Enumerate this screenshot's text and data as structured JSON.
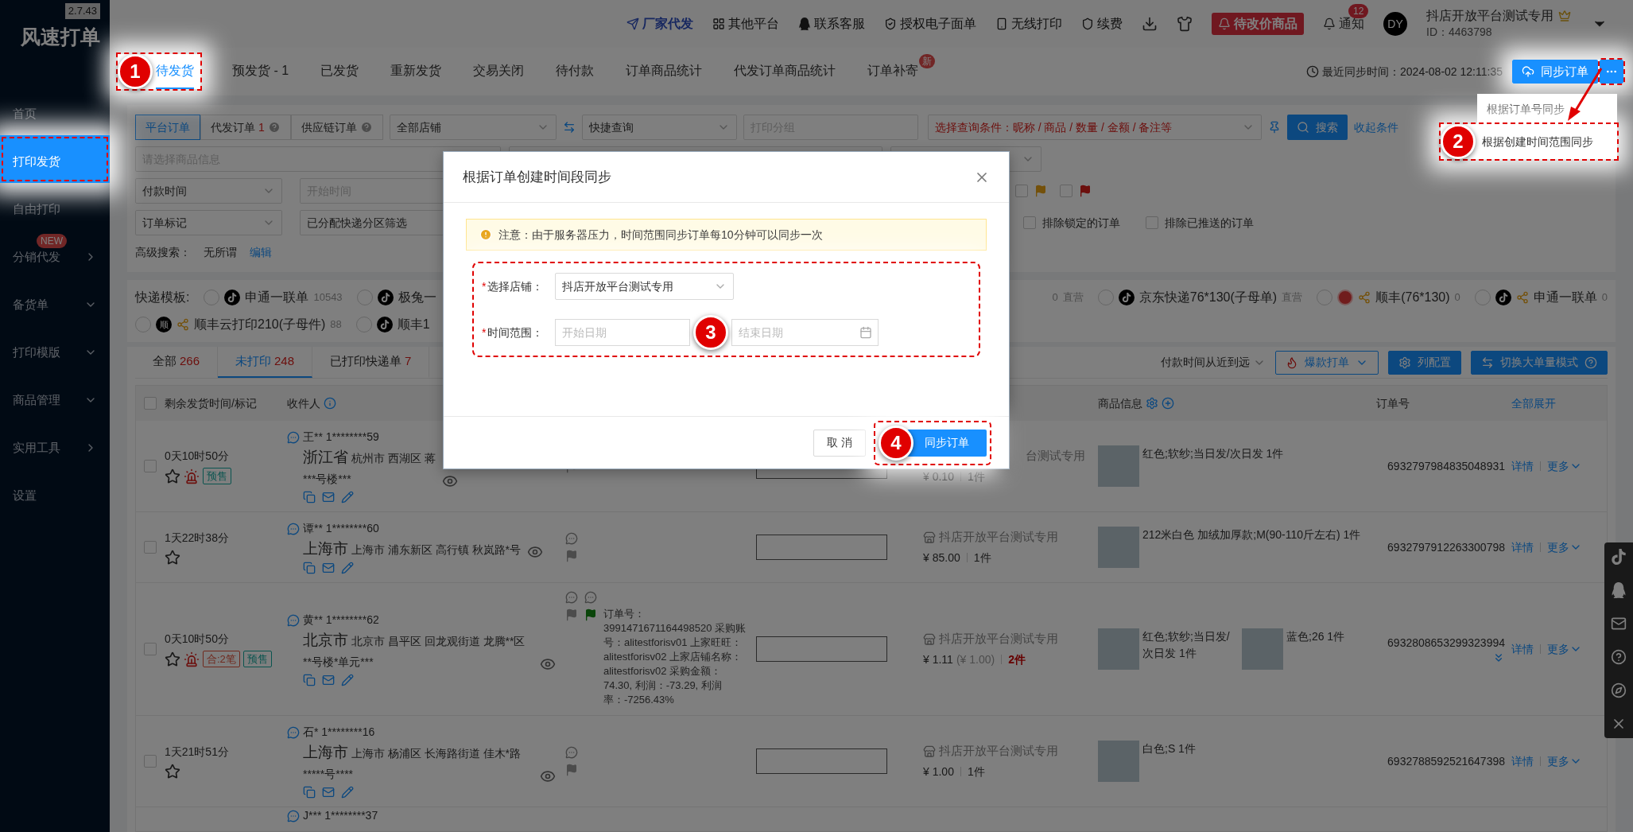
{
  "app": {
    "version": "2.7.43",
    "logo": "风速打单"
  },
  "sidebar": [
    {
      "label": "首页",
      "selected": false
    },
    {
      "label": "打印发货",
      "selected": true
    },
    {
      "label": "自由打印",
      "selected": false
    },
    {
      "label": "分销代发",
      "selected": false,
      "badge": "NEW",
      "kind": "submenu"
    },
    {
      "label": "备货单",
      "selected": false,
      "kind": "group"
    },
    {
      "label": "打印模版",
      "selected": false,
      "kind": "group"
    },
    {
      "label": "商品管理",
      "selected": false,
      "kind": "group"
    },
    {
      "label": "实用工具",
      "selected": false,
      "kind": "submenu"
    },
    {
      "label": "设置",
      "selected": false
    }
  ],
  "header": {
    "links": [
      {
        "label": "厂家代发",
        "kind": "featured"
      },
      {
        "label": "其他平台",
        "kind": "plain"
      },
      {
        "label": "联系客服",
        "kind": "plain"
      },
      {
        "label": "授权电子面单",
        "kind": "plain"
      },
      {
        "label": "无线打印",
        "kind": "plain"
      },
      {
        "label": "续费",
        "kind": "plain"
      }
    ],
    "alert_button": "待改价商品",
    "notifications": {
      "label": "通知",
      "count": "12"
    },
    "user": {
      "avatar": "DY",
      "name": "抖店开放平台测试专用",
      "id": "ID：4463798"
    }
  },
  "tabs": [
    {
      "label": "待发货",
      "selected": true
    },
    {
      "label": "预发货 - 1",
      "selected": false
    },
    {
      "label": "已发货",
      "selected": false
    },
    {
      "label": "重新发货",
      "selected": false
    },
    {
      "label": "交易关闭",
      "selected": false
    },
    {
      "label": "待付款",
      "selected": false
    },
    {
      "label": "订单商品统计",
      "selected": false
    },
    {
      "label": "代发订单商品统计",
      "selected": false
    },
    {
      "label": "订单补寄",
      "selected": false,
      "badge": "新"
    }
  ],
  "sync": {
    "last_sync": "最近同步时间：2024-08-02 12:11:35",
    "button": "同步订单",
    "menu_open": true,
    "menu": [
      "根据订单号同步",
      "根据创建时间范围同步"
    ]
  },
  "filters": {
    "sources": [
      {
        "label": "平台订单",
        "selected": true
      },
      {
        "label": "代发订单",
        "count": "1",
        "help": true,
        "selected": false
      },
      {
        "label": "供应链订单",
        "help": true,
        "selected": false
      }
    ],
    "shop_select": "全部店铺",
    "quick_query": "快捷查询",
    "print_group_placeholder": "打印分组",
    "condition_select": "选择查询条件：昵称 / 商品 / 数量 / 金额 / 备注等",
    "search_button": "搜索",
    "collapse_link": "收起条件",
    "product_placeholder": "请选择商品信息",
    "time_type": "付款时间",
    "start_time_placeholder": "开始时间",
    "flags": [
      {
        "color": "#74510b",
        "checked": false
      },
      {
        "color": "#6c100e",
        "checked": false
      }
    ],
    "mark_select": "订单标记",
    "zone_select": "已分配快递分区筛选",
    "checkboxes": [
      {
        "label": "排除锁定的订单",
        "checked": false
      },
      {
        "label": "排除已推送的订单",
        "checked": false
      }
    ],
    "advanced": {
      "label": "高级搜索：",
      "value": "无所谓",
      "link": "编辑"
    }
  },
  "templates": {
    "label": "快递模板:",
    "rows": [
      {
        "left": [
          {
            "name": "申通一联单",
            "count": "10543",
            "kind": "douyin",
            "selected": false
          },
          {
            "name": "极兔一",
            "kind": "douyin",
            "selected": false
          }
        ],
        "right": [
          {
            "count": "0",
            "tag": "直营"
          },
          {
            "name": "京东快递76*130(子母单)",
            "tag": "直营",
            "kind": "douyin",
            "selected": false
          },
          {
            "name": "顺丰(76*130)",
            "count": "0",
            "kind": "sf",
            "shared": true,
            "selected": false
          },
          {
            "name": "申通一联单",
            "count": "0",
            "kind": "douyin",
            "shared": true,
            "selected": false
          }
        ]
      },
      {
        "left": [
          {
            "name": "顺丰云打印210(子母件)",
            "count": "88",
            "kind": "shunfeng",
            "logo_text": "顺",
            "shared": true,
            "selected": false
          },
          {
            "name": "顺丰1",
            "kind": "douyin",
            "selected": false
          }
        ],
        "right": []
      }
    ]
  },
  "orders": {
    "tabs": [
      {
        "label": "全部",
        "count": "266",
        "selected": false
      },
      {
        "label": "未打印",
        "count": "248",
        "selected": true
      },
      {
        "label": "已打印快递单",
        "count": "7",
        "selected": false
      }
    ],
    "sort": "付款时间从近到远",
    "tools": [
      {
        "label": "爆款打单",
        "kind": "outline"
      },
      {
        "label": "列配置",
        "kind": "primary"
      },
      {
        "label": "切换大单量模式",
        "kind": "primary",
        "help": true
      }
    ],
    "columns": {
      "time": "剩余发货时间/标记",
      "recipient": "收件人",
      "product": "商品信息",
      "order_no": "订单号",
      "expand_all": "全部展开"
    },
    "select_all_checked": false,
    "rows": [
      {
        "checked": false,
        "remaining": "0天10时50分",
        "starred": false,
        "alarm": true,
        "tags": [
          {
            "label": "预售",
            "color": "#0a544f"
          }
        ],
        "name": "王** 1********59",
        "province": "浙江省",
        "address": "杭州市 西湖区 蒋",
        "address_cont": "***号楼***",
        "buyer_message": false,
        "seller_memo": false,
        "shop": "台测试专用",
        "shop_icon": false,
        "price": "¥ 0.10",
        "quantity": "1件",
        "quantity_alert": false,
        "products": [
          "红色;软纱;当日发/次日发 1件"
        ],
        "order_no": "6932797984835048931",
        "more_products": false,
        "actions": [
          "详情",
          "更多"
        ]
      },
      {
        "checked": false,
        "remaining": "1天22时38分",
        "starred": false,
        "alarm": false,
        "tags": [],
        "name": "谭** 1********60",
        "province": "上海市",
        "address": "上海市 浦东新区 高行镇 秋岚路*号",
        "buyer_message": true,
        "seller_memo": false,
        "shop": "抖店开放平台测试专用",
        "shop_icon": true,
        "price": "¥ 85.00",
        "quantity": "1件",
        "quantity_alert": false,
        "products": [
          "212米白色 加绒加厚款;M(90-110斤左右) 1件"
        ],
        "order_no": "6932797912263300798",
        "more_products": false,
        "actions": [
          "详情",
          "更多"
        ]
      },
      {
        "checked": false,
        "remaining": "0天10时50分",
        "starred": false,
        "alarm": true,
        "tags": [
          {
            "label": "合:2笔",
            "color": "#70291d"
          },
          {
            "label": "预售",
            "color": "#0a544f"
          }
        ],
        "name": "黄** 1********62",
        "province": "北京市",
        "address": "北京市 昌平区 回龙观街道 龙腾**区**号楼*单元***",
        "buyer_message": true,
        "seller_memo": true,
        "note": {
          "color": "#0a450a",
          "text": "订单号：3991471671164498520 采购账号：alitestforisv01 上家旺旺：alitestforisv02 上家店铺名称：alitestforisv02 采购金额：74.30, 利润：-73.29, 利润率：-7256.43%"
        },
        "shop": "抖店开放平台测试专用",
        "shop_icon": true,
        "price": "¥ 1.11",
        "original_price": "(¥ 1.00)",
        "quantity": "2件",
        "quantity_alert": true,
        "products": [
          "红色;软纱;当日发/次日发 1件",
          "蓝色;26 1件"
        ],
        "order_no": "6932808653299323994",
        "more_products": true,
        "actions": [
          "详情",
          "更多"
        ]
      },
      {
        "checked": false,
        "remaining": "1天21时51分",
        "starred": false,
        "alarm": false,
        "tags": [],
        "name": "石* 1********16",
        "province": "上海市",
        "address": "上海市 杨浦区 长海路街道 佳木*路*****号****",
        "buyer_message": true,
        "seller_memo": false,
        "shop": "抖店开放平台测试专用",
        "shop_icon": true,
        "price": "¥ 1.00",
        "quantity": "1件",
        "quantity_alert": false,
        "products": [
          "白色;S 1件"
        ],
        "order_no": "6932788592521647398",
        "more_products": false,
        "actions": [
          "详情",
          "更多"
        ]
      }
    ],
    "partial_row": {
      "name": "J*** 1********37"
    }
  },
  "dialog": {
    "title": "根据订单创建时间段同步",
    "notice": "注意：由于服务器压力，时间范围同步订单每10分钟可以同步一次",
    "fields": [
      {
        "kind": "select",
        "required_mark": "*",
        "label": "选择店铺：",
        "value": "抖店开放平台测试专用"
      },
      {
        "kind": "daterange",
        "required_mark": "*",
        "label": "时间范围：",
        "start_placeholder": "开始日期",
        "end_placeholder": "结束日期"
      }
    ],
    "buttons": [
      {
        "label": "取 消",
        "kind": "default"
      },
      {
        "label": "同步订单",
        "kind": "primary"
      }
    ]
  },
  "callouts": [
    "1",
    "2",
    "3",
    "4"
  ]
}
